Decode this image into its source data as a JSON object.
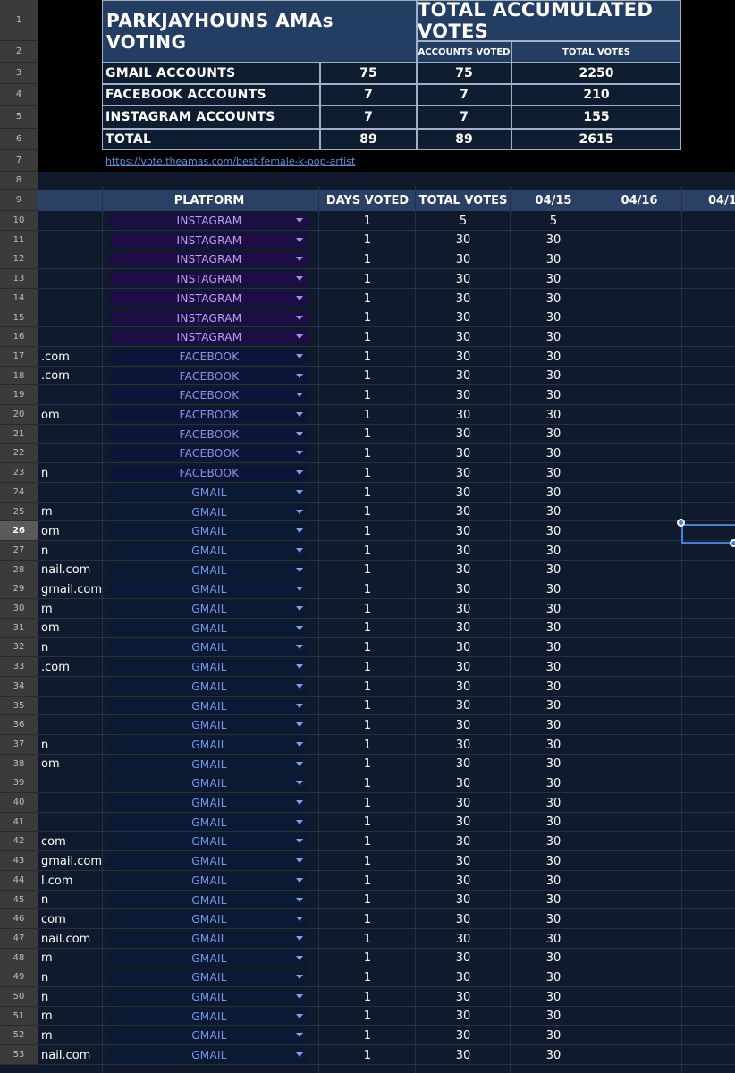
{
  "summary": {
    "title": "PARKJAYHOUNS AMAs VOTING",
    "total_title": "TOTAL ACCUMULATED VOTES",
    "accounts_voted_label": "ACCOUNTS VOTED",
    "total_votes_label": "TOTAL VOTES",
    "rows": [
      {
        "label": "GMAIL ACCOUNTS",
        "accounts": "75",
        "voted": "75",
        "votes": "2250"
      },
      {
        "label": "FACEBOOK ACCOUNTS",
        "accounts": "7",
        "voted": "7",
        "votes": "210"
      },
      {
        "label": "INSTAGRAM ACCOUNTS",
        "accounts": "7",
        "voted": "7",
        "votes": "155"
      },
      {
        "label": "TOTAL",
        "accounts": "89",
        "voted": "89",
        "votes": "2615"
      }
    ],
    "link": "https://vote.theamas.com/best-female-k-pop-artist"
  },
  "table": {
    "headers": {
      "platform": "PLATFORM",
      "days_voted": "DAYS VOTED",
      "total_votes": "TOTAL VOTES",
      "d1": "04/15",
      "d2": "04/16",
      "d3": "04/1"
    },
    "rows": [
      {
        "num": "10",
        "email": "",
        "platform": "INSTAGRAM",
        "days": "1",
        "total": "5",
        "d1": "5"
      },
      {
        "num": "11",
        "email": "",
        "platform": "INSTAGRAM",
        "days": "1",
        "total": "30",
        "d1": "30"
      },
      {
        "num": "12",
        "email": "",
        "platform": "INSTAGRAM",
        "days": "1",
        "total": "30",
        "d1": "30"
      },
      {
        "num": "13",
        "email": "",
        "platform": "INSTAGRAM",
        "days": "1",
        "total": "30",
        "d1": "30"
      },
      {
        "num": "14",
        "email": "",
        "platform": "INSTAGRAM",
        "days": "1",
        "total": "30",
        "d1": "30"
      },
      {
        "num": "15",
        "email": "",
        "platform": "INSTAGRAM",
        "days": "1",
        "total": "30",
        "d1": "30"
      },
      {
        "num": "16",
        "email": "",
        "platform": "INSTAGRAM",
        "days": "1",
        "total": "30",
        "d1": "30"
      },
      {
        "num": "17",
        "email": ".com",
        "platform": "FACEBOOK",
        "days": "1",
        "total": "30",
        "d1": "30"
      },
      {
        "num": "18",
        "email": ".com",
        "platform": "FACEBOOK",
        "days": "1",
        "total": "30",
        "d1": "30"
      },
      {
        "num": "19",
        "email": "",
        "platform": "FACEBOOK",
        "days": "1",
        "total": "30",
        "d1": "30"
      },
      {
        "num": "20",
        "email": "om",
        "platform": "FACEBOOK",
        "days": "1",
        "total": "30",
        "d1": "30"
      },
      {
        "num": "21",
        "email": "",
        "platform": "FACEBOOK",
        "days": "1",
        "total": "30",
        "d1": "30"
      },
      {
        "num": "22",
        "email": "",
        "platform": "FACEBOOK",
        "days": "1",
        "total": "30",
        "d1": "30"
      },
      {
        "num": "23",
        "email": "n",
        "platform": "FACEBOOK",
        "days": "1",
        "total": "30",
        "d1": "30"
      },
      {
        "num": "24",
        "email": "",
        "platform": "GMAIL",
        "days": "1",
        "total": "30",
        "d1": "30"
      },
      {
        "num": "25",
        "email": "m",
        "platform": "GMAIL",
        "days": "1",
        "total": "30",
        "d1": "30"
      },
      {
        "num": "26",
        "email": "om",
        "platform": "GMAIL",
        "days": "1",
        "total": "30",
        "d1": "30"
      },
      {
        "num": "27",
        "email": "n",
        "platform": "GMAIL",
        "days": "1",
        "total": "30",
        "d1": "30"
      },
      {
        "num": "28",
        "email": "nail.com",
        "platform": "GMAIL",
        "days": "1",
        "total": "30",
        "d1": "30"
      },
      {
        "num": "29",
        "email": "gmail.com",
        "platform": "GMAIL",
        "days": "1",
        "total": "30",
        "d1": "30"
      },
      {
        "num": "30",
        "email": "m",
        "platform": "GMAIL",
        "days": "1",
        "total": "30",
        "d1": "30"
      },
      {
        "num": "31",
        "email": "om",
        "platform": "GMAIL",
        "days": "1",
        "total": "30",
        "d1": "30"
      },
      {
        "num": "32",
        "email": "n",
        "platform": "GMAIL",
        "days": "1",
        "total": "30",
        "d1": "30"
      },
      {
        "num": "33",
        "email": ".com",
        "platform": "GMAIL",
        "days": "1",
        "total": "30",
        "d1": "30"
      },
      {
        "num": "34",
        "email": "",
        "platform": "GMAIL",
        "days": "1",
        "total": "30",
        "d1": "30"
      },
      {
        "num": "35",
        "email": "",
        "platform": "GMAIL",
        "days": "1",
        "total": "30",
        "d1": "30"
      },
      {
        "num": "36",
        "email": "",
        "platform": "GMAIL",
        "days": "1",
        "total": "30",
        "d1": "30"
      },
      {
        "num": "37",
        "email": "n",
        "platform": "GMAIL",
        "days": "1",
        "total": "30",
        "d1": "30"
      },
      {
        "num": "38",
        "email": "om",
        "platform": "GMAIL",
        "days": "1",
        "total": "30",
        "d1": "30"
      },
      {
        "num": "39",
        "email": "",
        "platform": "GMAIL",
        "days": "1",
        "total": "30",
        "d1": "30"
      },
      {
        "num": "40",
        "email": "",
        "platform": "GMAIL",
        "days": "1",
        "total": "30",
        "d1": "30"
      },
      {
        "num": "41",
        "email": "",
        "platform": "GMAIL",
        "days": "1",
        "total": "30",
        "d1": "30"
      },
      {
        "num": "42",
        "email": "com",
        "platform": "GMAIL",
        "days": "1",
        "total": "30",
        "d1": "30"
      },
      {
        "num": "43",
        "email": "gmail.com",
        "platform": "GMAIL",
        "days": "1",
        "total": "30",
        "d1": "30"
      },
      {
        "num": "44",
        "email": "l.com",
        "platform": "GMAIL",
        "days": "1",
        "total": "30",
        "d1": "30"
      },
      {
        "num": "45",
        "email": "n",
        "platform": "GMAIL",
        "days": "1",
        "total": "30",
        "d1": "30"
      },
      {
        "num": "46",
        "email": "com",
        "platform": "GMAIL",
        "days": "1",
        "total": "30",
        "d1": "30"
      },
      {
        "num": "47",
        "email": "nail.com",
        "platform": "GMAIL",
        "days": "1",
        "total": "30",
        "d1": "30"
      },
      {
        "num": "48",
        "email": "m",
        "platform": "GMAIL",
        "days": "1",
        "total": "30",
        "d1": "30"
      },
      {
        "num": "49",
        "email": "n",
        "platform": "GMAIL",
        "days": "1",
        "total": "30",
        "d1": "30"
      },
      {
        "num": "50",
        "email": "n",
        "platform": "GMAIL",
        "days": "1",
        "total": "30",
        "d1": "30"
      },
      {
        "num": "51",
        "email": "m",
        "platform": "GMAIL",
        "days": "1",
        "total": "30",
        "d1": "30"
      },
      {
        "num": "52",
        "email": "m",
        "platform": "GMAIL",
        "days": "1",
        "total": "30",
        "d1": "30"
      },
      {
        "num": "53",
        "email": "nail.com",
        "platform": "GMAIL",
        "days": "1",
        "total": "30",
        "d1": "30"
      }
    ]
  },
  "top_row_numbers": [
    "1",
    "2",
    "3",
    "4",
    "5",
    "6",
    "7",
    "8",
    "9"
  ],
  "selected_row": "26"
}
